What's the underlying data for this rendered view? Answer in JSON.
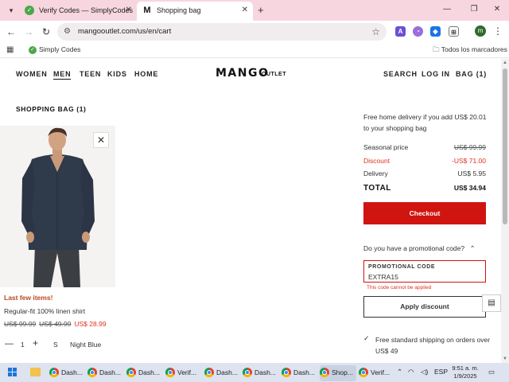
{
  "browser": {
    "tabs": [
      {
        "title": "Verify Codes — SimplyCodes",
        "favicon": "check-icon",
        "active": false
      },
      {
        "title": "Shopping bag",
        "favicon": "m-icon",
        "active": true
      }
    ],
    "url": "mangooutlet.com/us/en/cart",
    "profile_initial": "m",
    "bookmarks": {
      "item": "Simply Codes",
      "all": "Todos los marcadores"
    }
  },
  "site": {
    "nav_left": [
      "WOMEN",
      "MEN",
      "TEEN",
      "KIDS",
      "HOME"
    ],
    "nav_active": "MEN",
    "logo": "MANGO",
    "logo_sub": "OUTLET",
    "nav_right": {
      "search": "SEARCH",
      "login": "LOG IN",
      "bag": "BAG (1)"
    }
  },
  "bag": {
    "heading": "SHOPPING BAG (1)",
    "item": {
      "stock_label": "Last few items!",
      "name": "Regular-fit 100% linen shirt",
      "original_price": "US$ 99.99",
      "previous_price": "US$ 49.99",
      "current_price": "US$ 28.99",
      "quantity": "1",
      "size": "S",
      "color": "Night Blue"
    }
  },
  "summary": {
    "free_delivery_msg": "Free home delivery if you add US$ 20.01 to your shopping bag",
    "seasonal_label": "Seasonal price",
    "seasonal_value": "US$ 99.99",
    "discount_label": "Discount",
    "discount_value": "-US$ 71.00",
    "delivery_label": "Delivery",
    "delivery_value": "US$ 5.95",
    "total_label": "TOTAL",
    "total_value": "US$ 34.94",
    "checkout_label": "Checkout",
    "promo_question": "Do you have a promotional code?",
    "promo_label": "PROMOTIONAL CODE",
    "promo_value": "EXTRA15",
    "promo_error": "This code cannot be applied",
    "apply_label": "Apply discount",
    "shipping_msg": "Free standard shipping on orders over US$ 49"
  },
  "taskbar": {
    "items": [
      "Dash...",
      "Dash...",
      "Dash...",
      "Verif...",
      "Dash...",
      "Dash...",
      "Dash...",
      "Shop...",
      "Verif..."
    ],
    "active_index": 7,
    "language": "ESP",
    "time": "9:51 a. m.",
    "date": "1/9/2025"
  },
  "colors": {
    "accent_red": "#d0140f",
    "discount_red": "#e0301e",
    "stock_orange": "#b9491a",
    "tabbar_pink": "#f7d6e0"
  }
}
